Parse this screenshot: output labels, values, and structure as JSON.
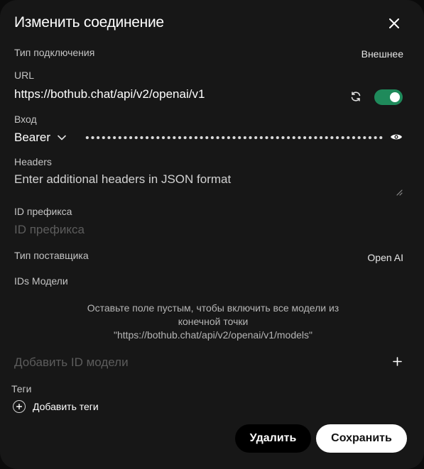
{
  "dialog": {
    "title": "Изменить соединение"
  },
  "connection_type": {
    "label": "Тип подключения",
    "value": "Внешнее"
  },
  "url": {
    "label": "URL",
    "value": "https://bothub.chat/api/v2/openai/v1",
    "enabled": true
  },
  "auth": {
    "label": "Вход",
    "type": "Bearer"
  },
  "headers": {
    "label": "Headers",
    "placeholder": "Enter additional headers in JSON format"
  },
  "prefix_id": {
    "label": "ID префикса",
    "placeholder": "ID префикса"
  },
  "provider_type": {
    "label": "Тип поставщика",
    "value": "Open AI"
  },
  "model_ids": {
    "label": "IDs Модели",
    "hint_line1": "Оставьте поле пустым, чтобы включить все модели из",
    "hint_line2": "конечной точки",
    "hint_line3": "\"https://bothub.chat/api/v2/openai/v1/models\"",
    "add_placeholder": "Добавить ID модели"
  },
  "tags": {
    "label": "Теги",
    "add_label": "Добавить теги"
  },
  "actions": {
    "delete_label": "Удалить",
    "save_label": "Сохранить"
  },
  "colors": {
    "background": "#171717",
    "toggle_on": "#1f8a5b",
    "save_button": "#ffffff",
    "delete_button": "#000000"
  },
  "icons": {
    "close": "close-icon",
    "refresh": "refresh-icon",
    "chevron": "chevron-down-icon",
    "eye": "eye-icon",
    "plus": "plus-icon",
    "add_tag": "plus-circle-icon"
  }
}
